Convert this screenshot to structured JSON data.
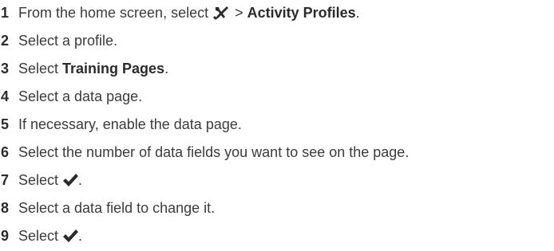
{
  "steps": [
    {
      "number": "1",
      "pre": "From the home screen, select ",
      "icon": "tools-icon",
      "mid": " > ",
      "bold": "Activity Profiles",
      "post": "."
    },
    {
      "number": "2",
      "text": "Select a profile."
    },
    {
      "number": "3",
      "pre": "Select ",
      "bold": "Training Pages",
      "post": "."
    },
    {
      "number": "4",
      "text": "Select a data page."
    },
    {
      "number": "5",
      "text": "If necessary, enable the data page."
    },
    {
      "number": "6",
      "text": "Select the number of data fields you want to see on the page."
    },
    {
      "number": "7",
      "pre": "Select ",
      "icon": "checkmark-icon",
      "post": "."
    },
    {
      "number": "8",
      "text": "Select a data field to change it."
    },
    {
      "number": "9",
      "pre": "Select ",
      "icon": "checkmark-icon",
      "post": "."
    }
  ]
}
